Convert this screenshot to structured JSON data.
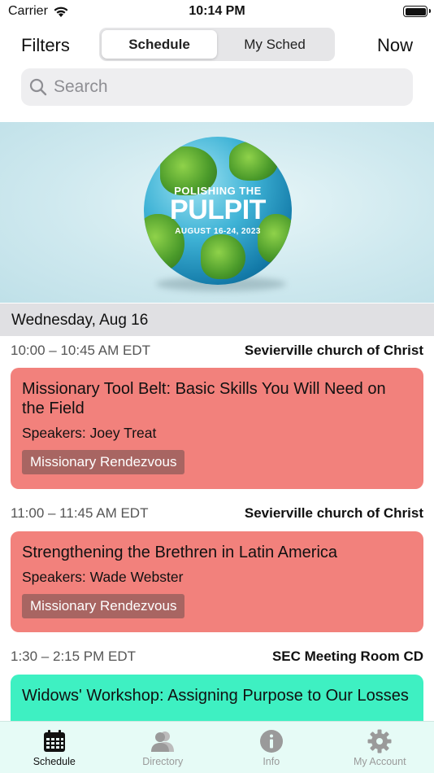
{
  "status_bar": {
    "carrier": "Carrier",
    "time": "10:14 PM",
    "battery_level": 1.0
  },
  "nav": {
    "filters_label": "Filters",
    "now_label": "Now",
    "segments": [
      "Schedule",
      "My Sched"
    ],
    "selected_segment": "Schedule"
  },
  "search": {
    "placeholder": "Search",
    "value": ""
  },
  "banner": {
    "line1": "POLISHING THE",
    "line2": "PULPIT",
    "dates": "AUGUST 16-24, 2023"
  },
  "day_header": "Wednesday, Aug 16",
  "sessions": [
    {
      "time": "10:00 – 10:45 AM EDT",
      "room": "Sevierville church of Christ",
      "title": "Missionary Tool Belt: Basic Skills You Will Need on the Field",
      "speakers": "Speakers: Joey Treat",
      "tag": "Missionary Rendezvous",
      "color": "#f2817c"
    },
    {
      "time": "11:00 – 11:45 AM EDT",
      "room": "Sevierville church of Christ",
      "title": "Strengthening the Brethren in Latin America",
      "speakers": "Speakers: Wade Webster",
      "tag": "Missionary Rendezvous",
      "color": "#f2817c"
    },
    {
      "time": "1:30 – 2:15 PM EDT",
      "room": "SEC Meeting Room CD",
      "title": "Widows' Workshop: Assigning Purpose to Our Losses",
      "color": "#3ef0c2"
    }
  ],
  "tabbar": {
    "tabs": [
      {
        "label": "Schedule",
        "icon": "calendar-icon"
      },
      {
        "label": "Directory",
        "icon": "people-icon"
      },
      {
        "label": "Info",
        "icon": "info-icon"
      },
      {
        "label": "My Account",
        "icon": "gear-icon"
      }
    ],
    "active": "Schedule"
  },
  "colors": {
    "accent_tag": "#a86562",
    "tabbar_bg": "#e6fbf6",
    "day_header_bg": "#e0e0e3"
  }
}
